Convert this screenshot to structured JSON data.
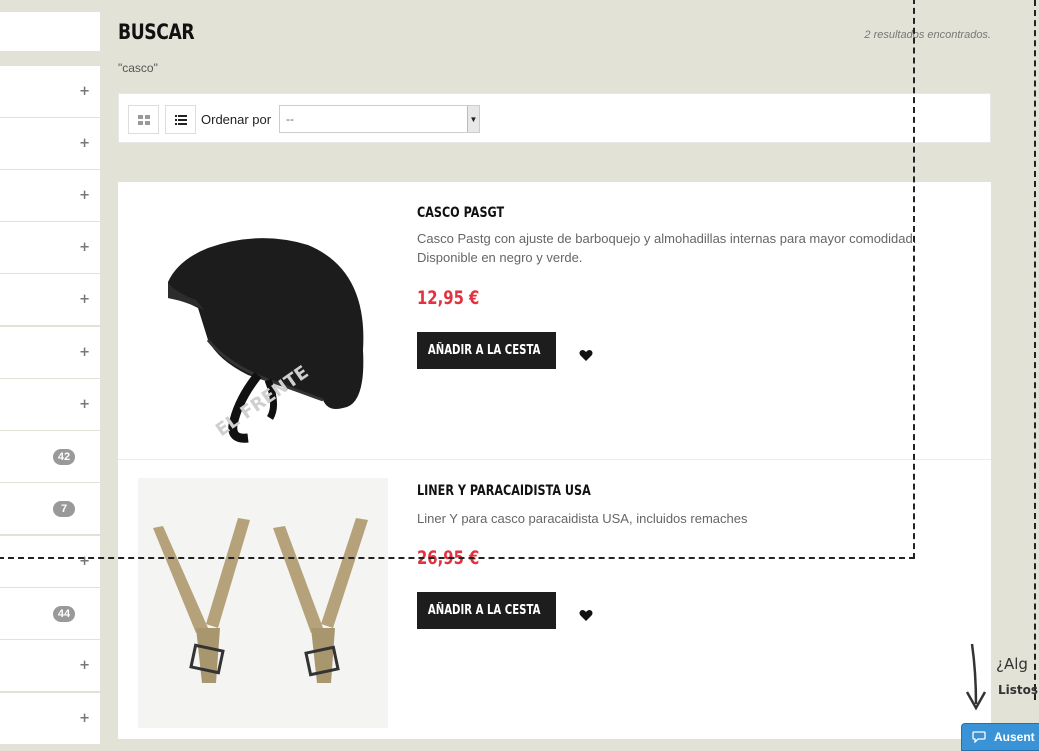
{
  "sidebar": {
    "rows": [
      {
        "type": "plus",
        "text": "+"
      },
      {
        "type": "plus",
        "text": "+"
      },
      {
        "type": "plus",
        "text": "+"
      },
      {
        "type": "plus",
        "text": "+"
      },
      {
        "type": "plus",
        "text": "+"
      },
      {
        "type": "plus",
        "text": "+"
      },
      {
        "type": "plus",
        "text": "+"
      },
      {
        "type": "badge",
        "text": "42"
      },
      {
        "type": "badge",
        "text": "7"
      },
      {
        "type": "plus",
        "text": "+"
      },
      {
        "type": "badge",
        "text": "44"
      },
      {
        "type": "plus",
        "text": "+"
      },
      {
        "type": "plus",
        "text": "+"
      }
    ]
  },
  "page": {
    "title": "BUSCAR",
    "results_count": "2 resultados encontrados.",
    "query": "\"casco\""
  },
  "toolbar": {
    "sort_label": "Ordenar por",
    "sort_selected": "--",
    "grid_icon": "grid-icon",
    "list_icon": "list-icon"
  },
  "products": [
    {
      "name": "CASCO PASGT",
      "description": "Casco Pastg con ajuste de barboquejo y almohadillas internas para mayor comodidad. Disponible en negro y verde.",
      "price": "12,95 €",
      "add_to_cart": "AÑADIR A LA CESTA",
      "image": "helmet-image"
    },
    {
      "name": "LINER Y PARACAIDISTA USA",
      "description": "Liner Y para casco paracaidista USA, incluidos remaches",
      "price": "26,95 €",
      "add_to_cart": "AÑADIR A LA CESTA",
      "image": "y-straps-image"
    }
  ],
  "chat": {
    "hint_line1": "¿Alg",
    "hint_line2": "Listos",
    "tab_label": "Ausent"
  },
  "colors": {
    "page_bg": "#e3e2d7",
    "price": "#e2323f",
    "button": "#1d1d1d",
    "chat": "#3a93d6"
  }
}
